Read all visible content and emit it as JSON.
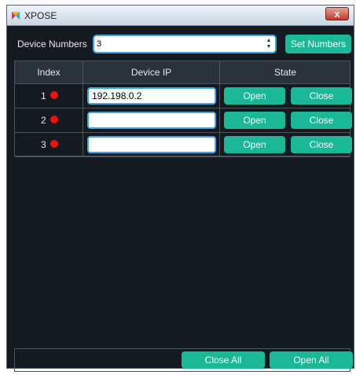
{
  "window": {
    "title": "XPOSE",
    "close_glyph": "x",
    "app_icon": "xpose-logo-icon"
  },
  "top": {
    "device_numbers_label": "Device Numbers",
    "device_numbers_value": "3",
    "set_numbers_label": "Set Numbers"
  },
  "table": {
    "headers": {
      "index": "Index",
      "ip": "Device IP",
      "state": "State"
    },
    "rows": [
      {
        "index": "1",
        "ip": "192.198.0.2",
        "open": "Open",
        "close": "Close",
        "status_color": "#ee1111"
      },
      {
        "index": "2",
        "ip": "",
        "open": "Open",
        "close": "Close",
        "status_color": "#ee1111"
      },
      {
        "index": "3",
        "ip": "",
        "open": "Open",
        "close": "Close",
        "status_color": "#ee1111"
      }
    ]
  },
  "bottom": {
    "close_all": "Close All",
    "open_all": "Open All"
  },
  "colors": {
    "accent": "#1bb897",
    "background": "#141a20",
    "status_red": "#ee1111",
    "focus_border": "#3fa6e8"
  }
}
